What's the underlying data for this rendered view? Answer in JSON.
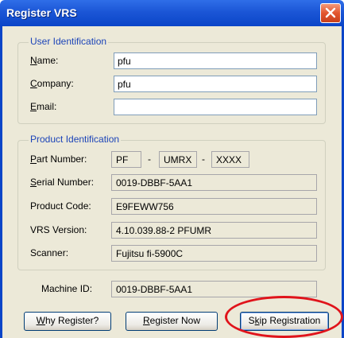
{
  "window": {
    "title": "Register VRS"
  },
  "user_identification": {
    "legend": "User Identification",
    "name": {
      "label_access": "N",
      "label_rest": "ame:",
      "value": "pfu"
    },
    "company": {
      "label_access": "C",
      "label_rest": "ompany:",
      "value": "pfu"
    },
    "email": {
      "label_access": "E",
      "label_rest": "mail:",
      "value": ""
    }
  },
  "product_identification": {
    "legend": "Product Identification",
    "part_number": {
      "label_access": "P",
      "label_rest": "art Number:",
      "part1": "PF",
      "separator1": "-",
      "part2": "UMRX",
      "separator2": "-",
      "part3": "XXXX"
    },
    "serial_number": {
      "label_access": "S",
      "label_rest": "erial Number:",
      "value": "0019-DBBF-5AA1"
    },
    "product_code": {
      "label": "Product Code:",
      "value": "E9FEWW756"
    },
    "vrs_version": {
      "label": "VRS Version:",
      "value": "4.10.039.88-2 PFUMR"
    },
    "scanner": {
      "label": "Scanner:",
      "value": "Fujitsu fi-5900C"
    }
  },
  "machine_id": {
    "label": "Machine ID:",
    "value": "0019-DBBF-5AA1"
  },
  "buttons": {
    "why_register": {
      "access": "W",
      "rest": "hy Register?"
    },
    "register_now": {
      "access": "R",
      "rest": "egister Now"
    },
    "skip_registration": {
      "pre": "S",
      "access": "k",
      "rest": "ip Registration"
    }
  },
  "colors": {
    "titlebar": "#0b45c8",
    "group_legend": "#1c44b8",
    "highlight_circle": "#e0141b"
  }
}
